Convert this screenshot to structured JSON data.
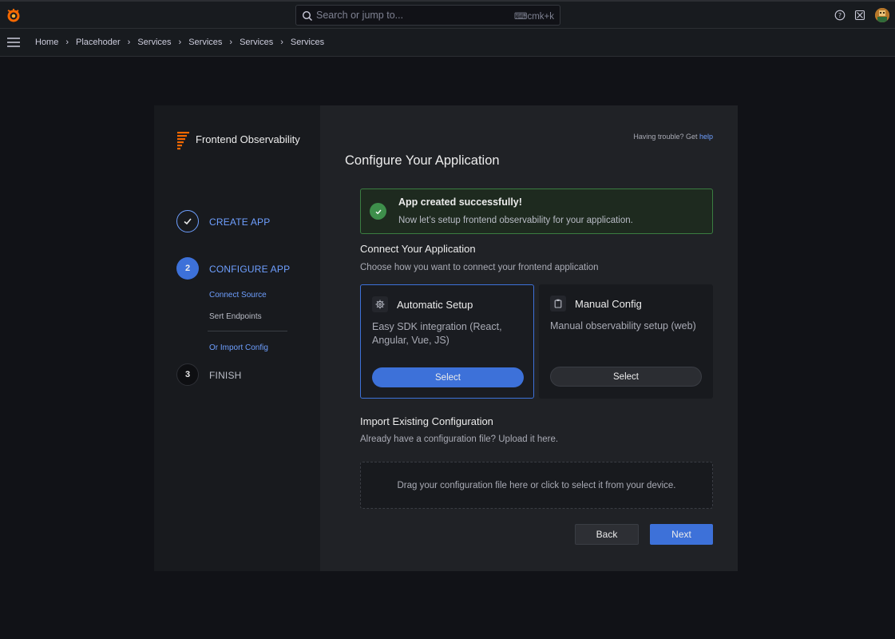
{
  "topbar": {
    "search_placeholder": "Search or jump to...",
    "search_shortcut": "⌨cmk+k"
  },
  "breadcrumbs": [
    "Home",
    "Placehoder",
    "Services",
    "Services",
    "Services",
    "Services"
  ],
  "sidebar": {
    "product_name": "Frontend Observability",
    "steps": [
      {
        "number": "✓",
        "label": "CREATE APP"
      },
      {
        "number": "2",
        "label": "CONFIGURE APP"
      },
      {
        "number": "3",
        "label": "FINISH"
      }
    ],
    "substeps": [
      "Connect Source",
      "Sert Endpoints"
    ],
    "import_link": "Or Import Config"
  },
  "main": {
    "help_prefix": "Having trouble? Get",
    "help_link": "help",
    "title": "Configure Your Application",
    "success": {
      "title": "App created successfully!",
      "message": "Now let’s setup frontend observability for your application."
    },
    "connect": {
      "title": "Connect Your Application",
      "subtitle": "Choose how you want to connect your frontend application"
    },
    "options": [
      {
        "title": "Automatic Setup",
        "description": "Easy SDK integration (React, Angular, Vue, JS)",
        "button": "Select",
        "icon": "gear-icon"
      },
      {
        "title": "Manual Config",
        "description": "Manual observability setup (web)",
        "button": "Select",
        "icon": "clipboard-icon"
      }
    ],
    "import": {
      "title": "Import Existing Configuration",
      "subtitle": "Already have a configuration file? Upload it here.",
      "dropzone": "Drag your configuration file here or click to select it from your device."
    },
    "back_label": "Back",
    "next_label": "Next"
  },
  "colors": {
    "accent": "#3d71d9",
    "link": "#6e9fff",
    "success": "#3e8f4b",
    "brand_orange": "#f46800"
  }
}
